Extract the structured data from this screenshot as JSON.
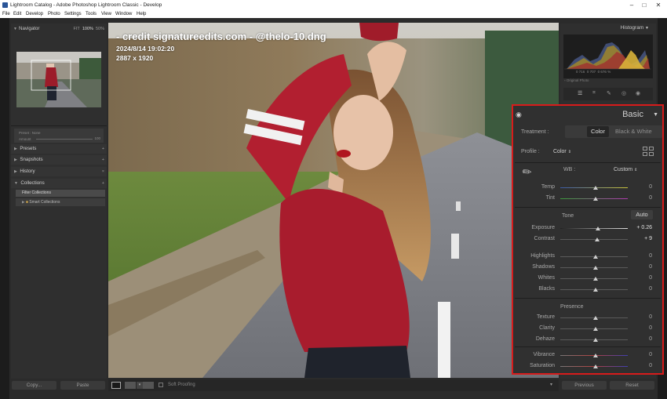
{
  "window": {
    "title": "Lightroom Catalog - Adobe Photoshop Lightroom Classic - Develop",
    "controls": [
      "–",
      "□",
      "✕"
    ]
  },
  "menu": [
    "File",
    "Edit",
    "Develop",
    "Photo",
    "Settings",
    "Tools",
    "View",
    "Window",
    "Help"
  ],
  "navigator": {
    "label": "Navigator",
    "zoom": [
      "FIT",
      "100%",
      "50%"
    ]
  },
  "preset_amount": {
    "label": "Preset",
    "value": "None",
    "amount_label": "Amount",
    "amount_value": "100"
  },
  "left_panels": [
    {
      "label": "Presets",
      "action": "+"
    },
    {
      "label": "Snapshots",
      "action": "+"
    },
    {
      "label": "History",
      "action": "×"
    },
    {
      "label": "Collections",
      "action": "+"
    }
  ],
  "collections": {
    "filter": "Filter Collections",
    "smart": "Smart Collections"
  },
  "left_buttons": {
    "copy": "Copy...",
    "paste": "Paste"
  },
  "overlay": {
    "line1": "- credit  signatureedits.com - @thelo-10.dng",
    "line2": "2024/8/14 19:02:20",
    "line3": "2887 x 1920"
  },
  "filmstrip": {
    "soft_proofing": "Soft Proofing"
  },
  "histogram": {
    "label": "Histogram",
    "readout": [
      "0",
      "716",
      "0",
      "707",
      "0",
      "676",
      "%"
    ],
    "original_photo": "Original Photo"
  },
  "basic": {
    "title": "Basic",
    "treatment_label": "Treatment :",
    "treatment_color": "Color",
    "treatment_bw": "Black & White",
    "profile_label": "Profile :",
    "profile_value": "Color",
    "wb_label": "WB :",
    "wb_value": "Custom",
    "tone_label": "Tone",
    "auto_label": "Auto",
    "presence_label": "Presence",
    "sliders": {
      "temp": {
        "label": "Temp",
        "value": "0"
      },
      "tint": {
        "label": "Tint",
        "value": "0"
      },
      "exposure": {
        "label": "Exposure",
        "value": "+ 0.26"
      },
      "contrast": {
        "label": "Contrast",
        "value": "+ 9"
      },
      "highlights": {
        "label": "Highlights",
        "value": "0"
      },
      "shadows": {
        "label": "Shadows",
        "value": "0"
      },
      "whites": {
        "label": "Whites",
        "value": "0"
      },
      "blacks": {
        "label": "Blacks",
        "value": "0"
      },
      "texture": {
        "label": "Texture",
        "value": "0"
      },
      "clarity": {
        "label": "Clarity",
        "value": "0"
      },
      "dehaze": {
        "label": "Dehaze",
        "value": "0"
      },
      "vibrance": {
        "label": "Vibrance",
        "value": "0"
      },
      "saturation": {
        "label": "Saturation",
        "value": "0"
      }
    }
  },
  "right_buttons": {
    "previous": "Previous",
    "reset": "Reset"
  },
  "colors": {
    "highlight_border": "#d81b1b",
    "accent": "#2a5598"
  }
}
